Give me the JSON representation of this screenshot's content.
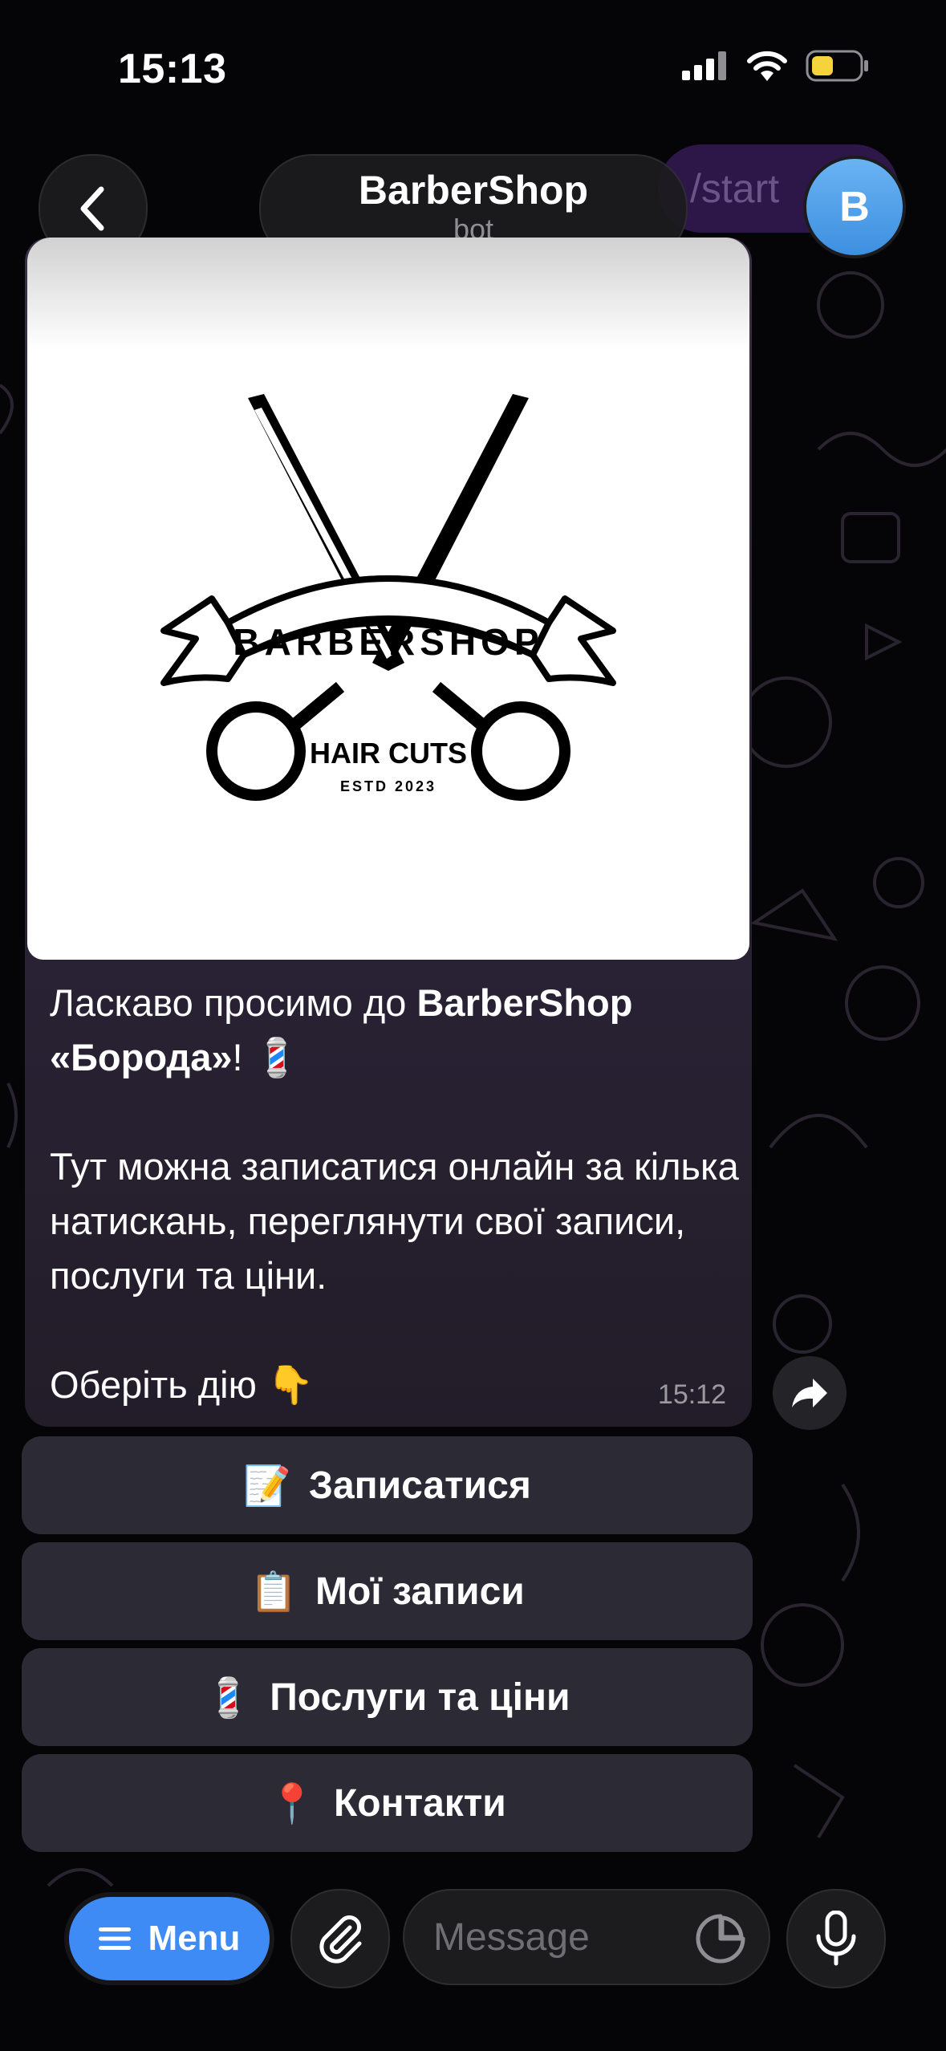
{
  "status_bar": {
    "time": "15:13"
  },
  "header": {
    "title": "BarberShop",
    "subtitle": "bot",
    "avatar_letter": "B",
    "behind_command": "/start"
  },
  "message": {
    "logo": {
      "main": "BARBERSHOP",
      "sub": "HAIR CUTS",
      "est": "ESTD 2023"
    },
    "line1_pre": "Ласкаво просимо до ",
    "line1_bold": "BarberShop «Борода»",
    "line1_post": "! 💈",
    "paragraph2": "Тут можна записатися онлайн за кілька натискань, переглянути свої записи, послуги та ціни.",
    "line3": "Оберіть дію 👇",
    "time": "15:12"
  },
  "keyboard": [
    {
      "emoji": "📝",
      "label": "Записатися"
    },
    {
      "emoji": "📋",
      "label": "Мої записи"
    },
    {
      "emoji": "💈",
      "label": "Послуги та ціни"
    },
    {
      "emoji": "📍",
      "label": "Контакти"
    }
  ],
  "composer": {
    "menu_label": "Menu",
    "placeholder": "Message"
  },
  "colors": {
    "accent": "#3e8bf5",
    "avatar": "#4a9de9",
    "battery": "#f5d33d"
  }
}
